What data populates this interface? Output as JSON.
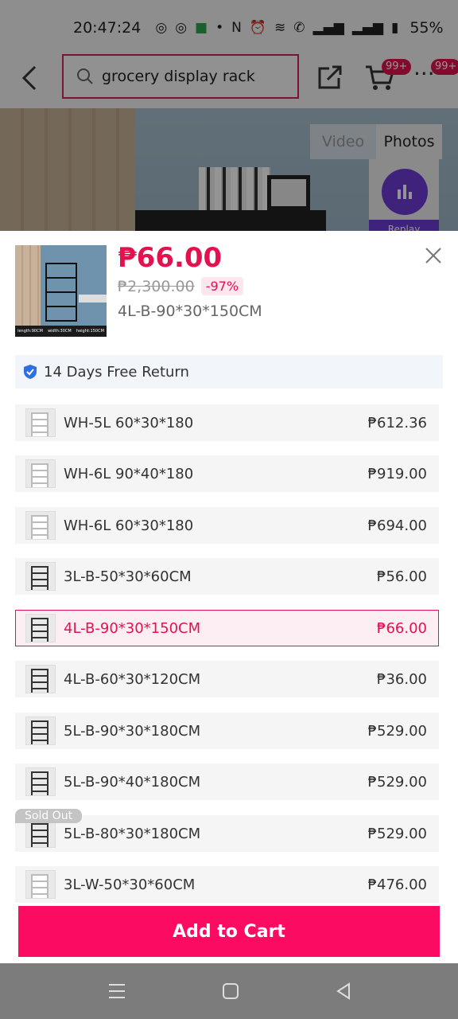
{
  "status_bar": {
    "time": "20:47:24",
    "battery": "55%"
  },
  "header": {
    "search_query": "grocery display rack",
    "cart_badge": "99+",
    "more_badge": "99+"
  },
  "hero": {
    "tabs": [
      "Video",
      "Photos"
    ],
    "active_tab": "Photos",
    "replay_label": "Replay"
  },
  "sheet": {
    "price": "₱66.00",
    "original_price": "₱2,300.00",
    "discount": "-97%",
    "selected_variant": "4L-B-90*30*150CM",
    "return_policy": "14 Days Free Return",
    "thumb_captions": [
      "length:90CM",
      "width:30CM",
      "height:150CM"
    ],
    "options": [
      {
        "name": "WH-5L 60*30*180",
        "price": "₱612.36"
      },
      {
        "name": "WH-6L 90*40*180",
        "price": "₱919.00"
      },
      {
        "name": "WH-6L 60*30*180",
        "price": "₱694.00"
      },
      {
        "name": "3L-B-50*30*60CM",
        "price": "₱56.00"
      },
      {
        "name": "4L-B-90*30*150CM",
        "price": "₱66.00"
      },
      {
        "name": "4L-B-60*30*120CM",
        "price": "₱36.00"
      },
      {
        "name": "5L-B-90*30*180CM",
        "price": "₱529.00"
      },
      {
        "name": "5L-B-90*40*180CM",
        "price": "₱529.00"
      },
      {
        "name": "5L-B-80*30*180CM",
        "price": "₱529.00",
        "badge": "Sold Out"
      },
      {
        "name": "3L-W-50*30*60CM",
        "price": "₱476.00"
      }
    ],
    "add_to_cart": "Add to Cart"
  },
  "colors": {
    "accent": "#fc0b62",
    "price": "#e3124f",
    "nav_bar": "#7c7c7c"
  }
}
